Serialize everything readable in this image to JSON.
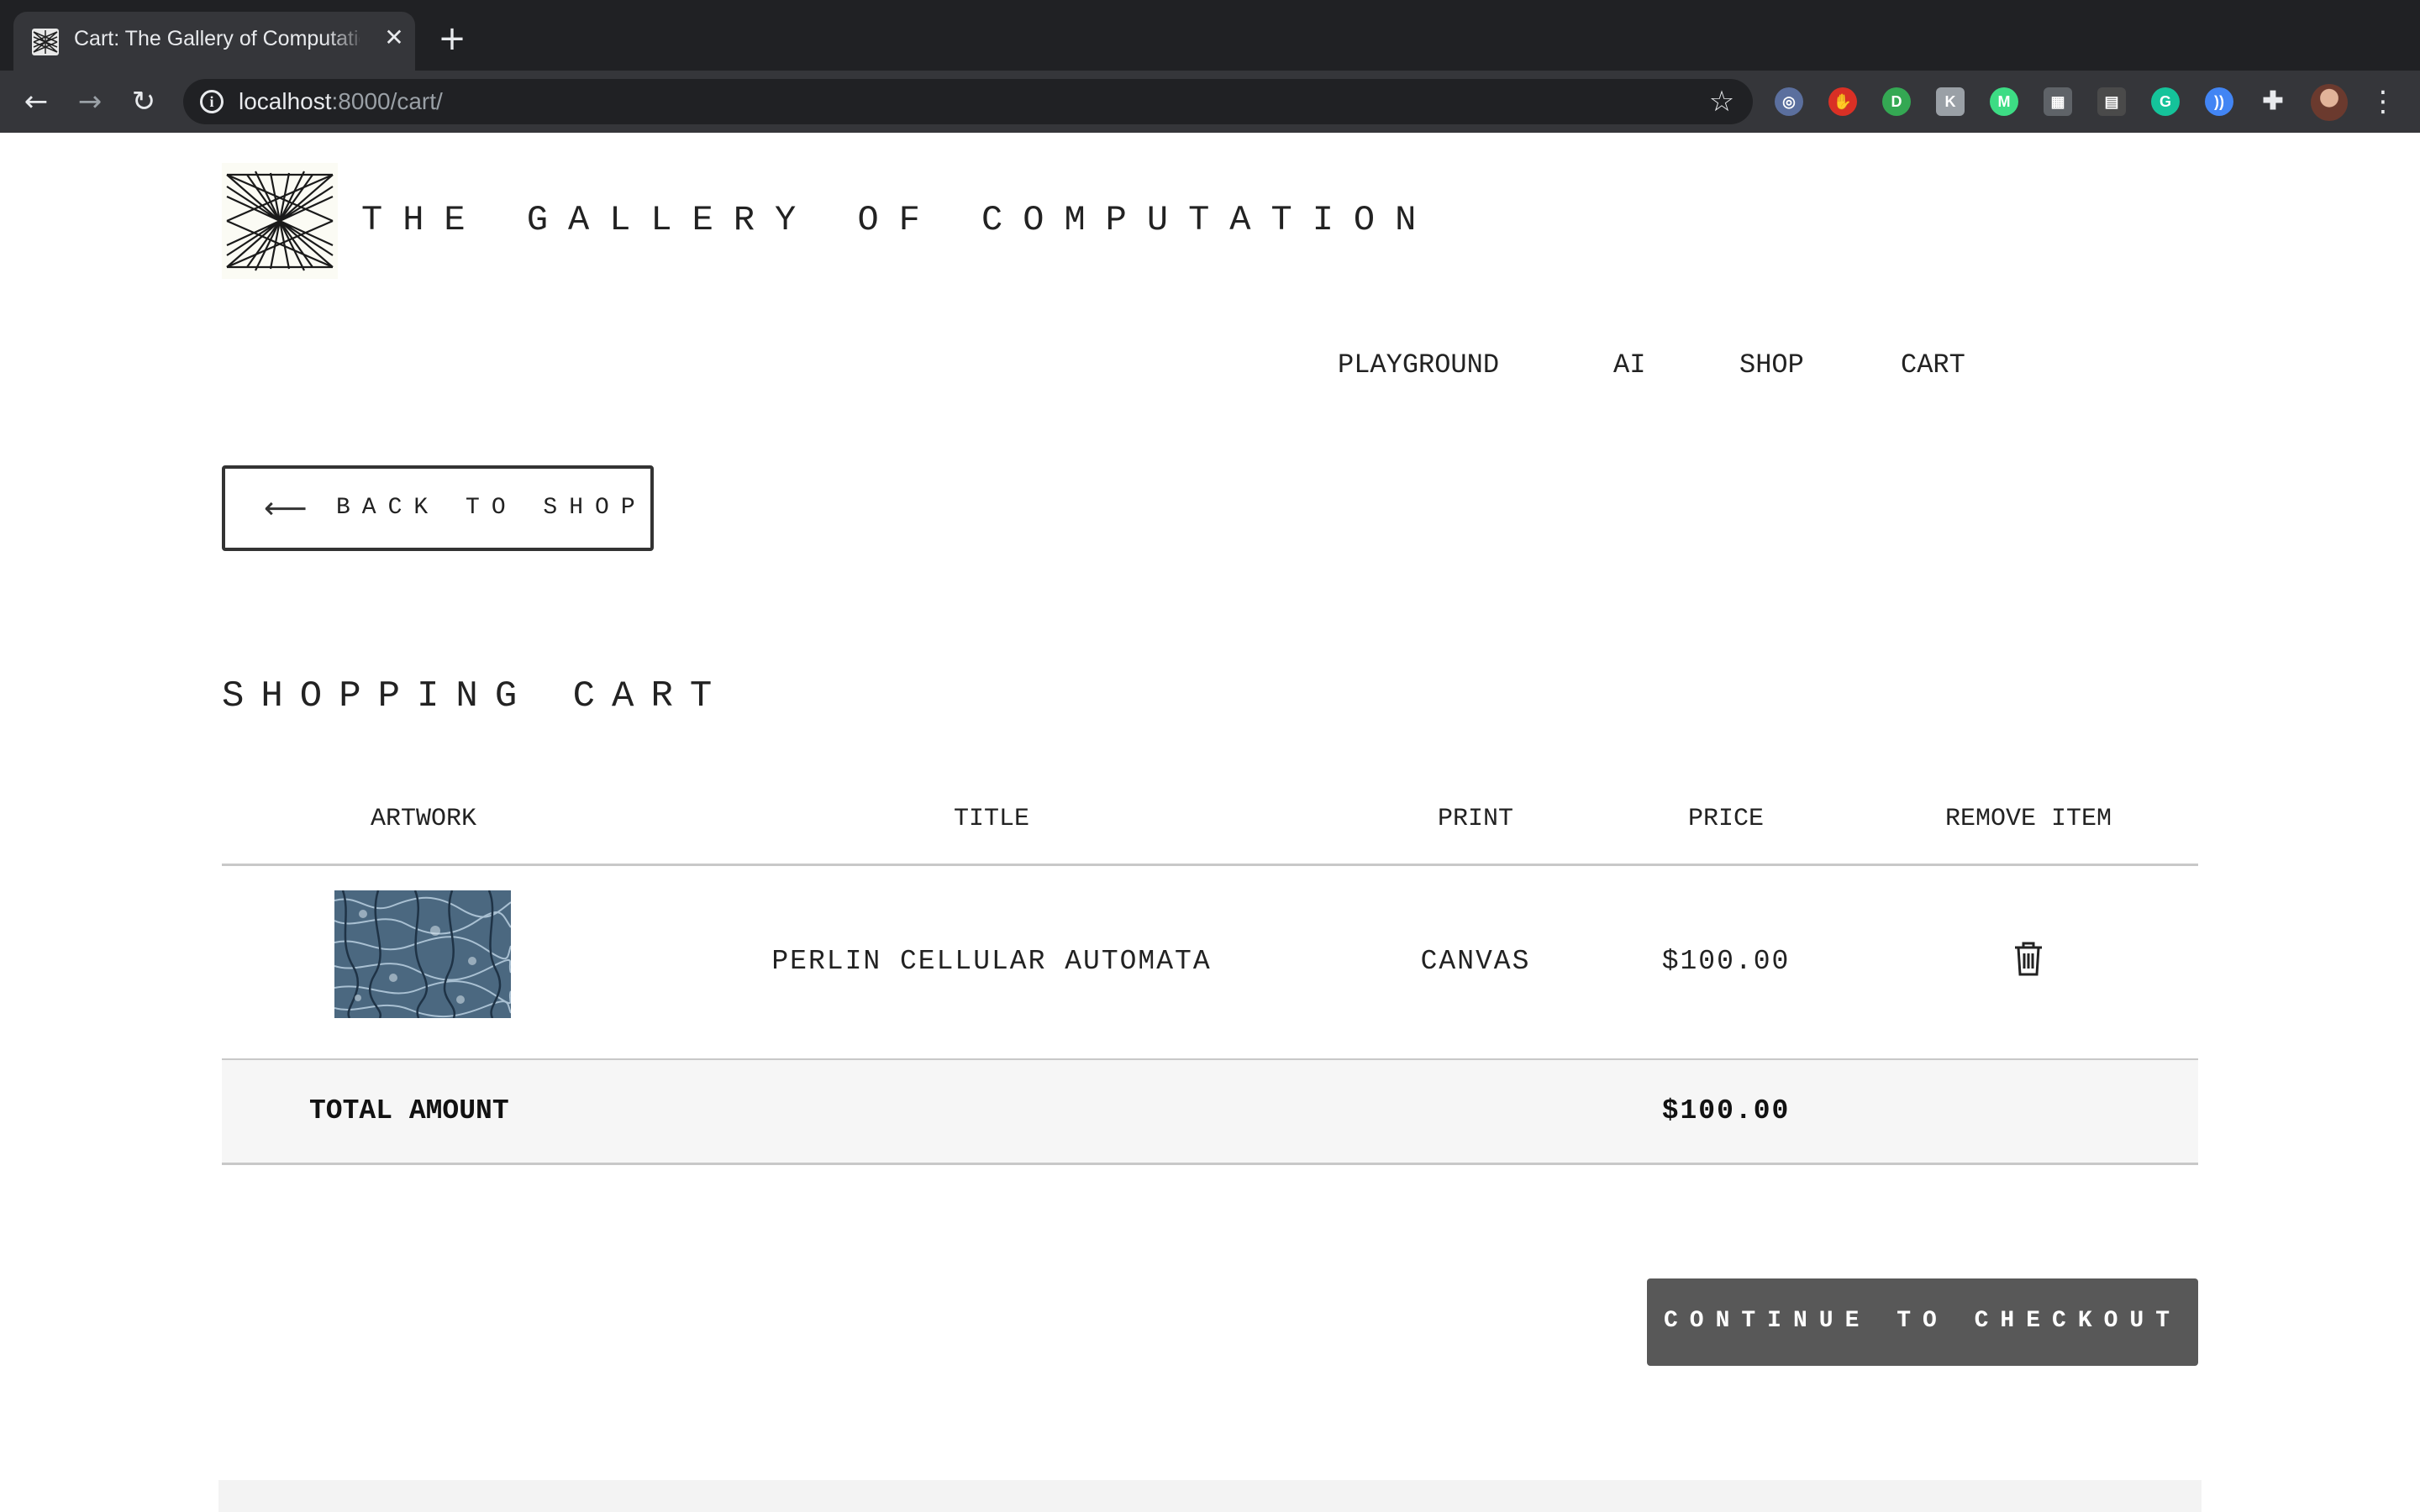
{
  "browser": {
    "tab_title": "Cart: The Gallery of Computation",
    "tab_close_glyph": "✕",
    "new_tab_glyph": "+",
    "back_glyph": "←",
    "forward_glyph": "→",
    "reload_glyph": "↻",
    "url_host": "localhost",
    "url_rest": ":8000/cart/",
    "info_glyph": "i",
    "star_glyph": "☆",
    "menu_glyph": "⋮",
    "extensions": [
      {
        "name": "extension-icon-1",
        "glyph": "◎",
        "color": "#5b6f9e"
      },
      {
        "name": "extension-icon-2",
        "glyph": "✋",
        "color": "#d93025"
      },
      {
        "name": "extension-icon-3",
        "glyph": "D",
        "color": "#34a853"
      },
      {
        "name": "extension-icon-4",
        "glyph": "K",
        "color": "#9aa0a6"
      },
      {
        "name": "extension-icon-5",
        "glyph": "M",
        "color": "#3ddc84"
      },
      {
        "name": "extension-icon-6",
        "glyph": "▦",
        "color": "#5f6368"
      },
      {
        "name": "extension-icon-7",
        "glyph": "▤",
        "color": "#4a4a4a"
      },
      {
        "name": "extension-icon-8",
        "glyph": "G",
        "color": "#15c39a"
      },
      {
        "name": "extension-icon-9",
        "glyph": "))",
        "color": "#4285f4"
      },
      {
        "name": "puzzle-icon",
        "glyph": "✚",
        "color": "#5f6368"
      }
    ]
  },
  "site": {
    "title": "THE GALLERY OF COMPUTATION",
    "nav": [
      "PLAYGROUND",
      "AI",
      "SHOP",
      "CART"
    ]
  },
  "back_button": {
    "arrow": "⟵",
    "label": "BACK TO SHOP"
  },
  "cart": {
    "heading": "SHOPPING CART",
    "columns": [
      "ARTWORK",
      "TITLE",
      "PRINT",
      "PRICE",
      "REMOVE ITEM"
    ],
    "items": [
      {
        "title": "PERLIN CELLULAR AUTOMATA",
        "print": "CANVAS",
        "price": "$100.00"
      }
    ],
    "total_label": "TOTAL AMOUNT",
    "total_value": "$100.00",
    "checkout_label": "CONTINUE TO CHECKOUT"
  },
  "colors": {
    "tabbar_bg": "#202124",
    "toolbar_bg": "#35363a",
    "checkout_bg": "#585858",
    "total_band_bg": "#f6f6f6",
    "rule": "#c8c8c8"
  }
}
